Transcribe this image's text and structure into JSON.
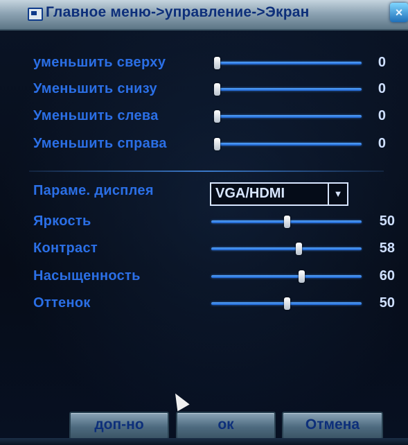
{
  "window": {
    "title": "Главное меню->управление->Экран",
    "close_label": "×"
  },
  "margins": [
    {
      "label": "уменьшить сверху",
      "value": 0,
      "value_text": "0"
    },
    {
      "label": "Уменьшить снизу",
      "value": 0,
      "value_text": "0"
    },
    {
      "label": "Уменьшить слева",
      "value": 0,
      "value_text": "0"
    },
    {
      "label": "Уменьшить справа",
      "value": 0,
      "value_text": "0"
    }
  ],
  "display": {
    "label": "Параме. дисплея",
    "selected": "VGA/HDMI",
    "arrow": "▼"
  },
  "adjustments": [
    {
      "label": "Яркость",
      "value": 50,
      "value_text": "50"
    },
    {
      "label": "Контраст",
      "value": 58,
      "value_text": "58"
    },
    {
      "label": "Насыщенность",
      "value": 60,
      "value_text": "60"
    },
    {
      "label": "Оттенок",
      "value": 50,
      "value_text": "50"
    }
  ],
  "buttons": {
    "advanced": "доп-но",
    "ok": "ок",
    "cancel": "Отмена"
  }
}
